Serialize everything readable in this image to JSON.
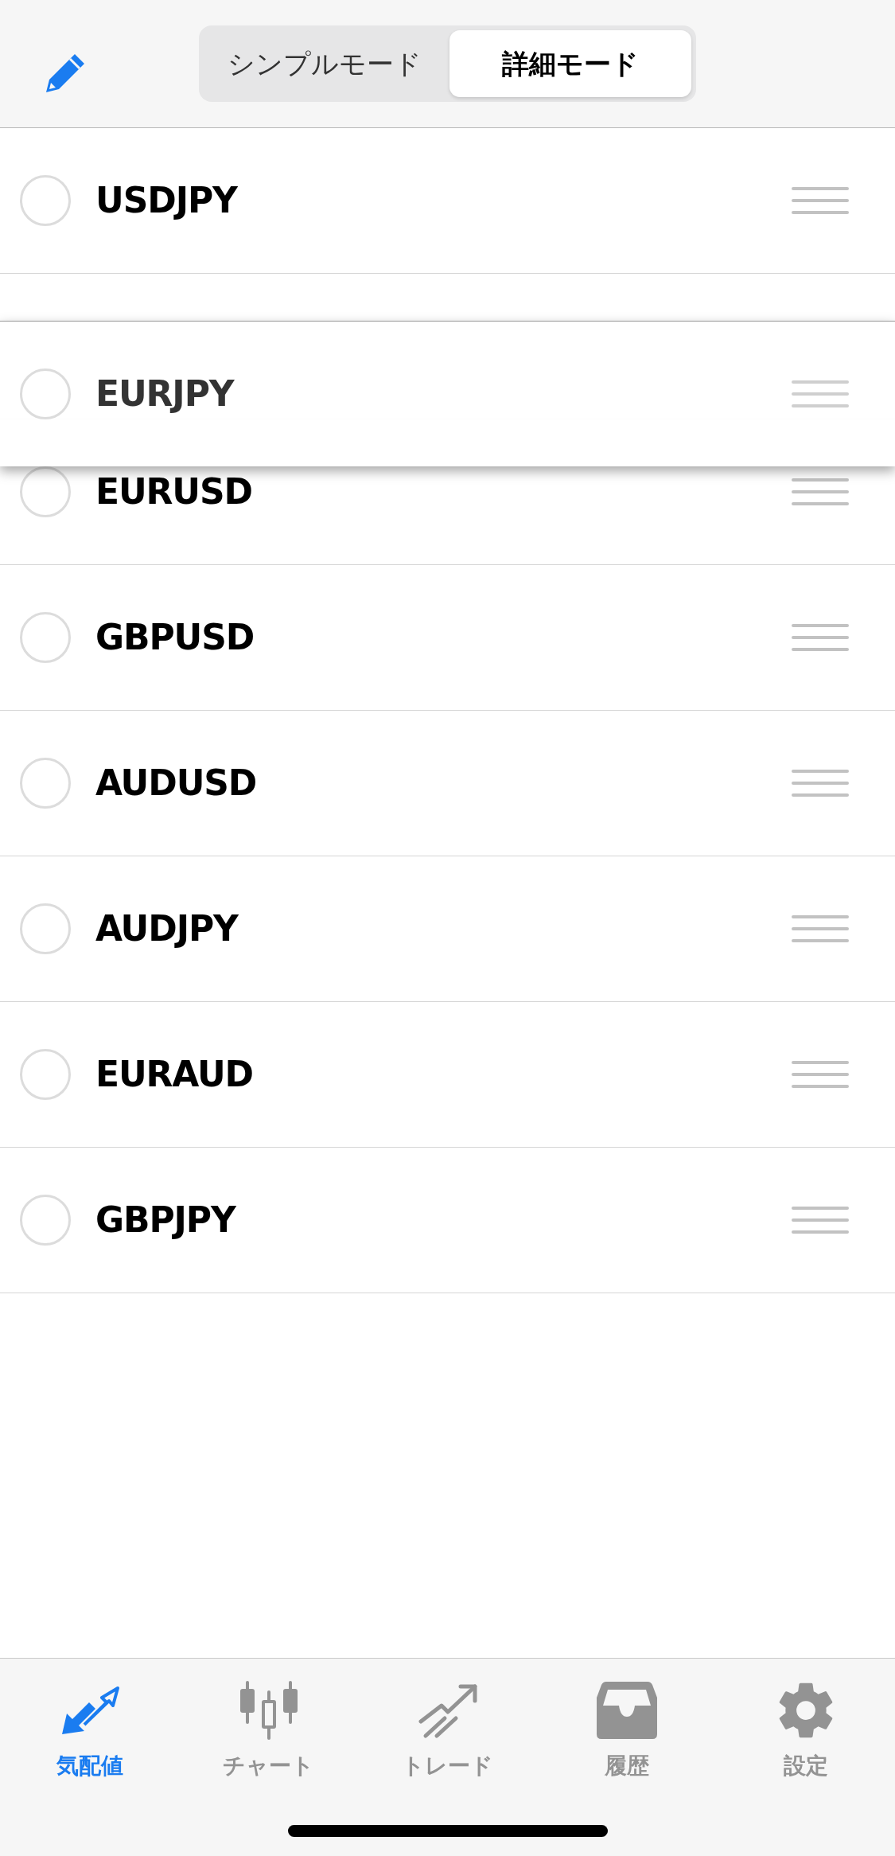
{
  "header": {
    "segments": [
      {
        "label": "シンプルモード",
        "selected": false
      },
      {
        "label": "詳細モード",
        "selected": true
      }
    ]
  },
  "rows": [
    {
      "symbol": "USDJPY",
      "checked": false,
      "dragging": false
    },
    {
      "symbol": "EURJPY",
      "checked": false,
      "dragging": true
    },
    {
      "symbol": "EURUSD",
      "checked": false,
      "dragging": false
    },
    {
      "symbol": "GBPUSD",
      "checked": false,
      "dragging": false
    },
    {
      "symbol": "AUDUSD",
      "checked": false,
      "dragging": false
    },
    {
      "symbol": "AUDJPY",
      "checked": false,
      "dragging": false
    },
    {
      "symbol": "EURAUD",
      "checked": false,
      "dragging": false
    },
    {
      "symbol": "GBPJPY",
      "checked": false,
      "dragging": false
    }
  ],
  "tab_bar": [
    {
      "label": "気配値",
      "selected": true
    },
    {
      "label": "チャート",
      "selected": false
    },
    {
      "label": "トレード",
      "selected": false
    },
    {
      "label": "履歴",
      "selected": false
    },
    {
      "label": "設定",
      "selected": false
    }
  ]
}
